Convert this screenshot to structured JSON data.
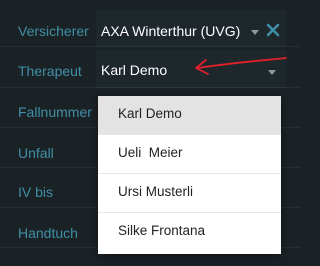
{
  "form": {
    "rows": [
      {
        "label": "Versicherer",
        "value": "AXA Winterthur (UVG)"
      },
      {
        "label": "Therapeut",
        "value": "Karl Demo"
      },
      {
        "label": "Fallnummer"
      },
      {
        "label": "Unfall"
      },
      {
        "label": "IV bis"
      },
      {
        "label": "Handtuch"
      }
    ]
  },
  "dropdown": {
    "options": [
      {
        "label": "Karl Demo",
        "selected": true
      },
      {
        "label": "Ueli  Meier"
      },
      {
        "label": "Ursi Musterli"
      },
      {
        "label": "Silke Frontana"
      }
    ]
  },
  "icons": {
    "clear": "close-icon",
    "caret": "chevron-down-icon"
  },
  "colors": {
    "background": "#1b2226",
    "label": "#3f8fa6",
    "value_text": "#ffffff",
    "annotation": "#e0202a",
    "selected_option": "#e3e3e3"
  }
}
